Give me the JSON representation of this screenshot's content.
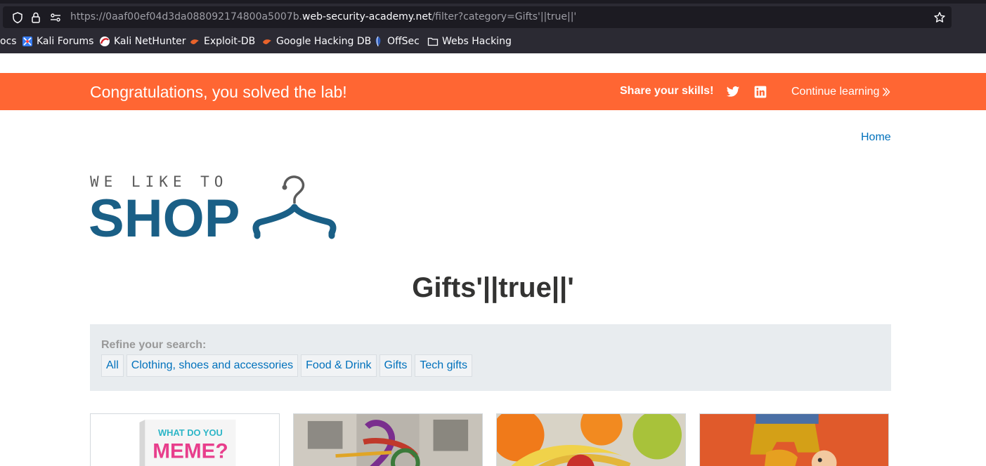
{
  "browser": {
    "url_prefix": "https://0aaf00ef04d3da088092174800a5007b.",
    "url_host": "web-security-academy.net",
    "url_suffix": "/filter?category=Gifts'||true||'",
    "bookmarks": [
      {
        "label": "ocs",
        "icon": "none"
      },
      {
        "label": "Kali Forums",
        "icon": "kali-forums-icon"
      },
      {
        "label": "Kali NetHunter",
        "icon": "kali-nethunter-icon"
      },
      {
        "label": "Exploit-DB",
        "icon": "exploit-db-icon"
      },
      {
        "label": "Google Hacking DB",
        "icon": "ghdb-icon"
      },
      {
        "label": "OffSec",
        "icon": "offsec-icon"
      },
      {
        "label": "Webs Hacking",
        "icon": "folder-icon"
      }
    ]
  },
  "banner": {
    "message": "Congratulations, you solved the lab!",
    "share_label": "Share your skills!",
    "continue_label": "Continue learning",
    "color": "#ff6633"
  },
  "nav": {
    "home_label": "Home"
  },
  "logo": {
    "line1": "WE LIKE TO",
    "line2": "SHOP",
    "icon": "hanger-icon"
  },
  "page": {
    "title": "Gifts'||true||'"
  },
  "filters": {
    "label": "Refine your search:",
    "items": [
      "All",
      "Clothing, shoes and accessories",
      "Food & Drink",
      "Gifts",
      "Tech gifts"
    ]
  },
  "products": [
    {
      "image": "meme-card-game"
    },
    {
      "image": "bicycle-street"
    },
    {
      "image": "fruit-bowl"
    },
    {
      "image": "orange-figurine"
    }
  ],
  "colors": {
    "link": "#0071bc",
    "logo_blue": "#1a5f86",
    "filter_bg": "#e8ecef"
  }
}
